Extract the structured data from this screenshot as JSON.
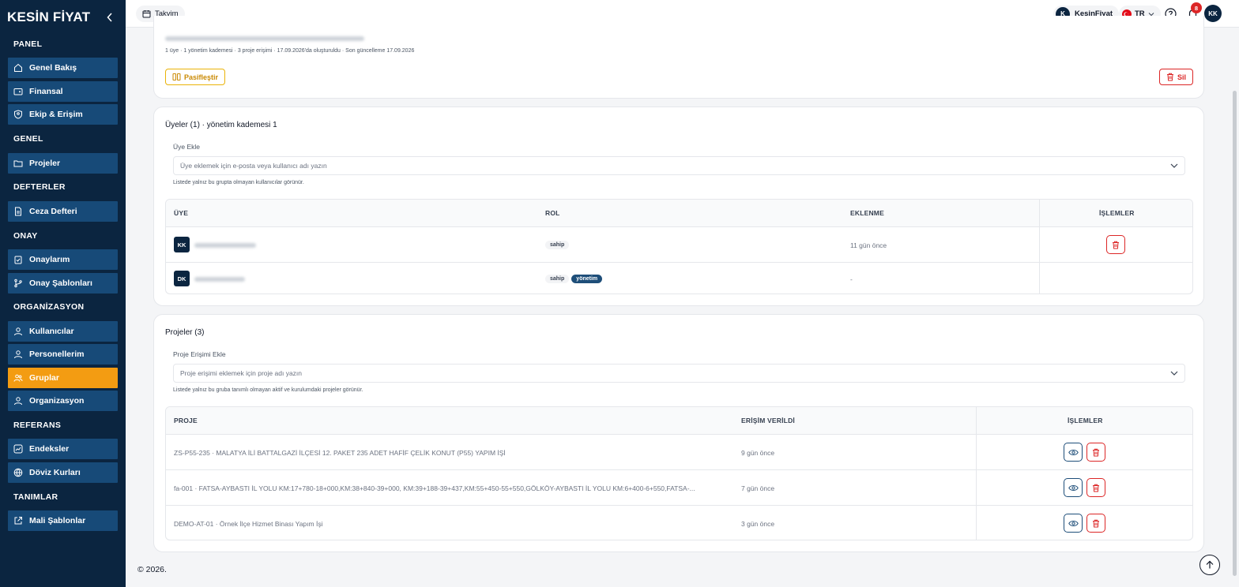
{
  "app": {
    "logo": "KESİN FİYAT"
  },
  "sidebar": {
    "sections": [
      {
        "label": "PANEL"
      },
      {
        "label": "GENEL"
      },
      {
        "label": "DEFTERLER"
      },
      {
        "label": "ONAY"
      },
      {
        "label": "ORGANİZASYON"
      },
      {
        "label": "REFERANS"
      },
      {
        "label": "TANIMLAR"
      }
    ],
    "items": [
      {
        "label": "Genel Bakış",
        "icon": "home-icon"
      },
      {
        "label": "Finansal",
        "icon": "wallet-icon"
      },
      {
        "label": "Ekip & Erişim",
        "icon": "shield-user-icon"
      },
      {
        "label": "Projeler",
        "icon": "folder-icon"
      },
      {
        "label": "Ceza Defteri",
        "icon": "document-icon"
      },
      {
        "label": "Onaylarım",
        "icon": "clipboard-check-icon"
      },
      {
        "label": "Onay Şablonları",
        "icon": "git-branch-icon"
      },
      {
        "label": "Kullanıcılar",
        "icon": "user-icon"
      },
      {
        "label": "Personellerim",
        "icon": "id-card-icon"
      },
      {
        "label": "Gruplar",
        "icon": "users-icon",
        "active": true
      },
      {
        "label": "Organizasyon",
        "icon": "user-icon"
      },
      {
        "label": "Endeksler",
        "icon": "chart-icon"
      },
      {
        "label": "Döviz Kurları",
        "icon": "globe-icon"
      },
      {
        "label": "Mali Şablonlar",
        "icon": "external-edit-icon"
      }
    ]
  },
  "topbar": {
    "calendar_label": "Takvim",
    "company_initial": "K",
    "company_name": "KesinFiyat",
    "language": "TR",
    "notification_count": "8",
    "user_initials": "KK"
  },
  "group_card": {
    "meta": "1 üye · 1 yönetim kademesi · 3 proje erişimi · 17.09.2026'da oluşturuldu · Son güncelleme 17.09.2026",
    "deactivate_label": "Pasifleştir",
    "delete_label": "Sil"
  },
  "members_card": {
    "title": "Üyeler (1) · yönetim kademesi 1",
    "add_label": "Üye Ekle",
    "add_placeholder": "Üye eklemek için e-posta veya kullanıcı adı yazın",
    "hint": "Listede yalnız bu grupta olmayan kullanıcılar görünür.",
    "columns": [
      "ÜYE",
      "ROL",
      "EKLENME",
      "İŞLEMLER"
    ],
    "rows": [
      {
        "initials": "KK",
        "roles": [
          "sahip"
        ],
        "added": "11 gün önce",
        "deletable": true
      },
      {
        "initials": "DK",
        "roles": [
          "sahip",
          "yönetim"
        ],
        "added": "-",
        "deletable": false
      }
    ]
  },
  "projects_card": {
    "title": "Projeler (3)",
    "add_label": "Proje Erişimi Ekle",
    "add_placeholder": "Proje erişimi eklemek için proje adı yazın",
    "hint": "Listede yalnız bu gruba tanımlı olmayan aktif ve kurulumdaki projeler görünür.",
    "columns": [
      "PROJE",
      "ERİŞİM VERİLDİ",
      "İŞLEMLER"
    ],
    "rows": [
      {
        "name": "ZS-P55-235 · MALATYA İLİ BATTALGAZİ İLÇESİ 12. PAKET 235 ADET HAFİF ÇELİK KONUT (P55) YAPIM İŞİ",
        "granted": "9 gün önce"
      },
      {
        "name": "fa-001 · FATSA-AYBASTI İL YOLU KM:17+780-18+000,KM:38+840-39+000, KM:39+188-39+437,KM:55+450-55+550,GÖLKÖY-AYBASTI İL YOLU KM:6+400-6+550,FATSA-...",
        "granted": "7 gün önce"
      },
      {
        "name": "DEMO-AT-01 · Örnek İlçe Hizmet Binası Yapım İşi",
        "granted": "3 gün önce"
      }
    ]
  },
  "footer": {
    "copyright": "© 2026."
  },
  "colors": {
    "sidebar_bg": "#0b2540",
    "sidebar_item": "#174a78",
    "active_item": "#f39c12",
    "danger": "#dc2626",
    "warning": "#eab308",
    "primary": "#1e4e79"
  }
}
